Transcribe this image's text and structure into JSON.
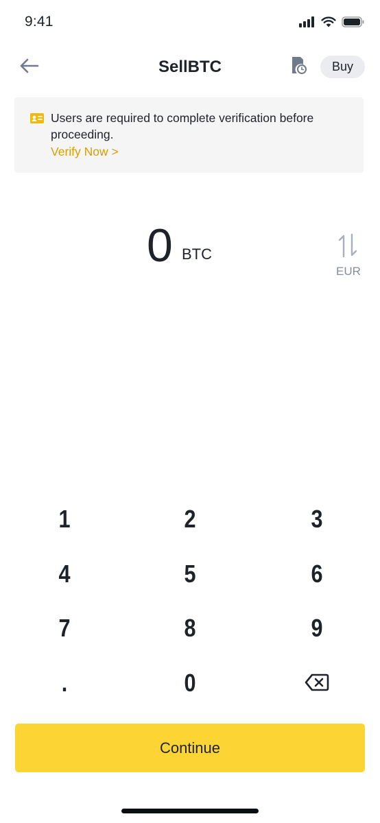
{
  "status_bar": {
    "time": "9:41"
  },
  "header": {
    "title": "SellBTC",
    "buy_label": "Buy"
  },
  "banner": {
    "message": "Users are required to complete verification before proceeding.",
    "link_label": "Verify Now >",
    "link_color": "#d89e00"
  },
  "amount": {
    "value": "0",
    "currency": "BTC",
    "alt_currency": "EUR"
  },
  "keypad": {
    "keys": [
      "1",
      "2",
      "3",
      "4",
      "5",
      "6",
      "7",
      "8",
      "9",
      ".",
      "0",
      "backspace"
    ]
  },
  "footer": {
    "continue_label": "Continue",
    "accent_color": "#fcd535"
  },
  "icons": [
    "signal-icon",
    "wifi-icon",
    "battery-icon",
    "back-arrow-icon",
    "history-icon",
    "id-card-icon",
    "swap-icon",
    "backspace-icon"
  ]
}
